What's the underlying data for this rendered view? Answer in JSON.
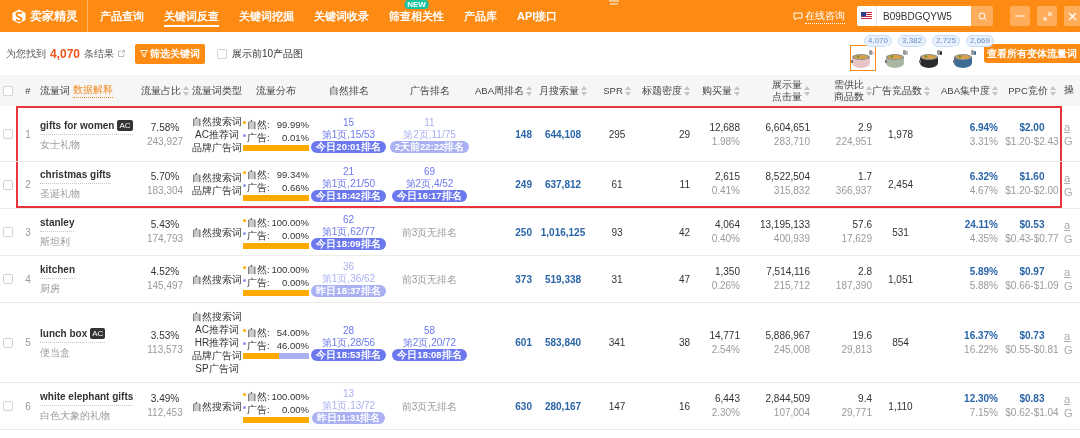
{
  "header": {
    "brand": "卖家精灵",
    "nav": [
      {
        "label": "产品查询",
        "selected": false
      },
      {
        "label": "关键词反查",
        "selected": true
      },
      {
        "label": "关键词挖掘",
        "selected": false
      },
      {
        "label": "关键词收录",
        "selected": false
      },
      {
        "label": "筛查相关性",
        "selected": false,
        "badge": "NEW"
      },
      {
        "label": "产品库",
        "selected": false
      },
      {
        "label": "API接口",
        "selected": false
      }
    ],
    "consult": "在线咨询",
    "search_value": "B09BDGQYW5"
  },
  "toolbar": {
    "result_prefix": "为您找到",
    "result_count": "4,070",
    "result_suffix": "条结果",
    "filter_button": "筛选关键词",
    "show_images": {
      "label": "展示前10产品图",
      "checked": false
    },
    "variants": [
      {
        "count": "4,070",
        "selected": true
      },
      {
        "count": "3,382",
        "selected": false
      },
      {
        "count": "2,725",
        "selected": false
      },
      {
        "count": "2,669",
        "selected": false
      }
    ],
    "variants_button": "查看所有变体流量词"
  },
  "table": {
    "select_all_checked": false,
    "columns": [
      {
        "labels": [
          "#"
        ],
        "sortable": false
      },
      {
        "labels": [
          "流量词"
        ],
        "link": "数据解释",
        "sortable": false
      },
      {
        "labels": [
          "流量占比"
        ],
        "sortable": true
      },
      {
        "labels": [
          "流量词类型"
        ],
        "sortable": false
      },
      {
        "labels": [
          "流量分布"
        ],
        "sortable": false
      },
      {
        "labels": [
          "自然排名"
        ],
        "sortable": false
      },
      {
        "labels": [
          "广告排名"
        ],
        "sortable": false
      },
      {
        "labels": [
          "ABA周排名"
        ],
        "sortable": true
      },
      {
        "labels": [
          "月搜索量"
        ],
        "sortable": true
      },
      {
        "labels": [
          "SPR"
        ],
        "sortable": true
      },
      {
        "labels": [
          "标题密度"
        ],
        "sortable": true
      },
      {
        "labels": [
          "购买量"
        ],
        "sortable": true
      },
      {
        "labels": [
          "展示量",
          "点击量"
        ],
        "sortable": true
      },
      {
        "labels": [
          "需供比",
          "商品数"
        ],
        "sortable": true
      },
      {
        "labels": [
          "广告竞品数"
        ],
        "sortable": true
      },
      {
        "labels": [
          "ABA集中度"
        ],
        "sortable": true
      },
      {
        "labels": [
          "PPC竞价"
        ],
        "sortable": true
      },
      {
        "labels": [
          "操"
        ],
        "sortable": false
      }
    ],
    "rows": [
      {
        "checked": false,
        "highlighted": true,
        "index": "1",
        "keyword": "gifts for women",
        "tag": "AC",
        "translation": "女士礼物",
        "share": "7.58%",
        "share_count": "243,927",
        "types": [
          "自然搜索词",
          "AC推荐词",
          "品牌广告词"
        ],
        "natural_label": "自然:",
        "natural_pct": "99.99%",
        "ad_label": "广告:",
        "ad_pct": "0.01%",
        "level": 0.9999,
        "natural_rank": {
          "kind": "ranked",
          "rank": "15",
          "page": "第1页,15/53",
          "badge": "今日20:01排名",
          "color": "#6c78ee"
        },
        "ad_rank": {
          "kind": "ranked",
          "rank": "11",
          "page": "第2页,11/75",
          "badge": "2天前22:22排名",
          "color": "#a9b1f3"
        },
        "aba": "148",
        "monthly": "644,108",
        "spr": "295",
        "density": "29",
        "purchases": "12,688",
        "purchase_rate": "1.98%",
        "impressions": "6,604,651",
        "clicks": "283,710",
        "ratio": "2.9",
        "products": "224,951",
        "ad_products": "1,978",
        "aba_conc": "6.94%",
        "aba_conc_2": "3.31%",
        "ppc": "$2.00",
        "ppc_range": "$1.20-$2.43",
        "op": [
          "a",
          "G"
        ]
      },
      {
        "checked": false,
        "highlighted": true,
        "index": "2",
        "keyword": "christmas gifts",
        "translation": "圣诞礼物",
        "share": "5.70%",
        "share_count": "183,304",
        "types": [
          "自然搜索词",
          "品牌广告词"
        ],
        "natural_label": "自然:",
        "natural_pct": "99.34%",
        "ad_label": "广告:",
        "ad_pct": "0.66%",
        "level": 0.9934,
        "natural_rank": {
          "kind": "ranked",
          "rank": "21",
          "page": "第1页,21/50",
          "badge": "今日18:42排名",
          "color": "#6c78ee"
        },
        "ad_rank": {
          "kind": "ranked",
          "rank": "69",
          "page": "第2页,4/52",
          "badge": "今日16:17排名",
          "color": "#6c78ee"
        },
        "aba": "249",
        "monthly": "637,812",
        "spr": "61",
        "density": "11",
        "purchases": "2,615",
        "purchase_rate": "0.41%",
        "impressions": "8,522,504",
        "clicks": "315,832",
        "ratio": "1.7",
        "products": "366,937",
        "ad_products": "2,454",
        "aba_conc": "6.32%",
        "aba_conc_2": "4.67%",
        "ppc": "$1.60",
        "ppc_range": "$1.20-$2.00",
        "op": [
          "a",
          "G"
        ]
      },
      {
        "checked": false,
        "highlighted": false,
        "index": "3",
        "keyword": "stanley",
        "translation": "斯坦利",
        "share": "5.43%",
        "share_count": "174,793",
        "types": [
          "自然搜索词"
        ],
        "natural_label": "自然:",
        "natural_pct": "100.00%",
        "ad_label": "广告:",
        "ad_pct": "0.00%",
        "level": 1,
        "natural_rank": {
          "kind": "ranked",
          "rank": "62",
          "page": "第1页,62/77",
          "badge": "今日18:09排名",
          "color": "#6c78ee"
        },
        "ad_rank": {
          "kind": "none",
          "text": "前3页无排名"
        },
        "aba": "250",
        "monthly": "1,016,125",
        "spr": "93",
        "density": "42",
        "purchases": "4,064",
        "purchase_rate": "0.40%",
        "impressions": "13,195,133",
        "clicks": "400,939",
        "ratio": "57.6",
        "products": "17,629",
        "ad_products": "531",
        "aba_conc": "24.11%",
        "aba_conc_2": "4.35%",
        "ppc": "$0.53",
        "ppc_range": "$0.43-$0.77",
        "op": [
          "a",
          "G"
        ]
      },
      {
        "checked": false,
        "highlighted": false,
        "index": "4",
        "keyword": "kitchen",
        "translation": "厨房",
        "share": "4.52%",
        "share_count": "145,497",
        "types": [
          "自然搜索词"
        ],
        "natural_label": "自然:",
        "natural_pct": "100.00%",
        "ad_label": "广告:",
        "ad_pct": "0.00%",
        "level": 1,
        "natural_rank": {
          "kind": "ranked",
          "rank": "36",
          "page": "第1页,36/62",
          "badge": "昨日18:37排名",
          "color": "#a9b1f3"
        },
        "ad_rank": {
          "kind": "none",
          "text": "前3页无排名"
        },
        "aba": "373",
        "monthly": "519,338",
        "spr": "31",
        "density": "47",
        "purchases": "1,350",
        "purchase_rate": "0.26%",
        "impressions": "7,514,116",
        "clicks": "215,712",
        "ratio": "2.8",
        "products": "187,390",
        "ad_products": "1,051",
        "aba_conc": "5.89%",
        "aba_conc_2": "5.88%",
        "ppc": "$0.97",
        "ppc_range": "$0.66-$1.09",
        "op": [
          "a",
          "G"
        ]
      },
      {
        "checked": false,
        "highlighted": false,
        "index": "5",
        "keyword": "lunch box",
        "tag": "AC",
        "translation": "便当盒",
        "share": "3.53%",
        "share_count": "113,573",
        "types": [
          "自然搜索词",
          "AC推荐词",
          "HR推荐词",
          "品牌广告词",
          "SP广告词"
        ],
        "natural_label": "自然:",
        "natural_pct": "54.00%",
        "ad_label": "广告:",
        "ad_pct": "46.00%",
        "level": 0.54,
        "natural_rank": {
          "kind": "ranked",
          "rank": "28",
          "page": "第1页,28/56",
          "badge": "今日18:53排名",
          "color": "#6c78ee"
        },
        "ad_rank": {
          "kind": "ranked",
          "rank": "58",
          "page": "第2页,20/72",
          "badge": "今日18:08排名",
          "color": "#6c78ee"
        },
        "aba": "601",
        "monthly": "583,840",
        "spr": "341",
        "density": "38",
        "purchases": "14,771",
        "purchase_rate": "2.54%",
        "impressions": "5,886,967",
        "clicks": "245,008",
        "ratio": "19.6",
        "products": "29,813",
        "ad_products": "854",
        "aba_conc": "16.37%",
        "aba_conc_2": "16.22%",
        "ppc": "$0.73",
        "ppc_range": "$0.55-$0.81",
        "op": [
          "a",
          "G"
        ]
      },
      {
        "checked": false,
        "highlighted": false,
        "index": "6",
        "keyword": "white elephant gifts",
        "translation": "白色大象的礼物",
        "share": "3.49%",
        "share_count": "112,453",
        "types": [
          "自然搜索词"
        ],
        "natural_label": "自然:",
        "natural_pct": "100.00%",
        "ad_label": "广告:",
        "ad_pct": "0.00%",
        "level": 1,
        "natural_rank": {
          "kind": "ranked",
          "rank": "13",
          "page": "第1页,13/72",
          "badge": "昨日11:31排名",
          "color": "#a9b1f3"
        },
        "ad_rank": {
          "kind": "none",
          "text": "前3页无排名"
        },
        "aba": "630",
        "monthly": "280,167",
        "spr": "147",
        "density": "16",
        "purchases": "6,443",
        "purchase_rate": "2.30%",
        "impressions": "2,844,509",
        "clicks": "107,004",
        "ratio": "9.4",
        "products": "29,771",
        "ad_products": "1,110",
        "aba_conc": "12.30%",
        "aba_conc_2": "7.15%",
        "ppc": "$0.83",
        "ppc_range": "$0.62-$1.04",
        "op": [
          "a",
          "G"
        ]
      }
    ]
  }
}
